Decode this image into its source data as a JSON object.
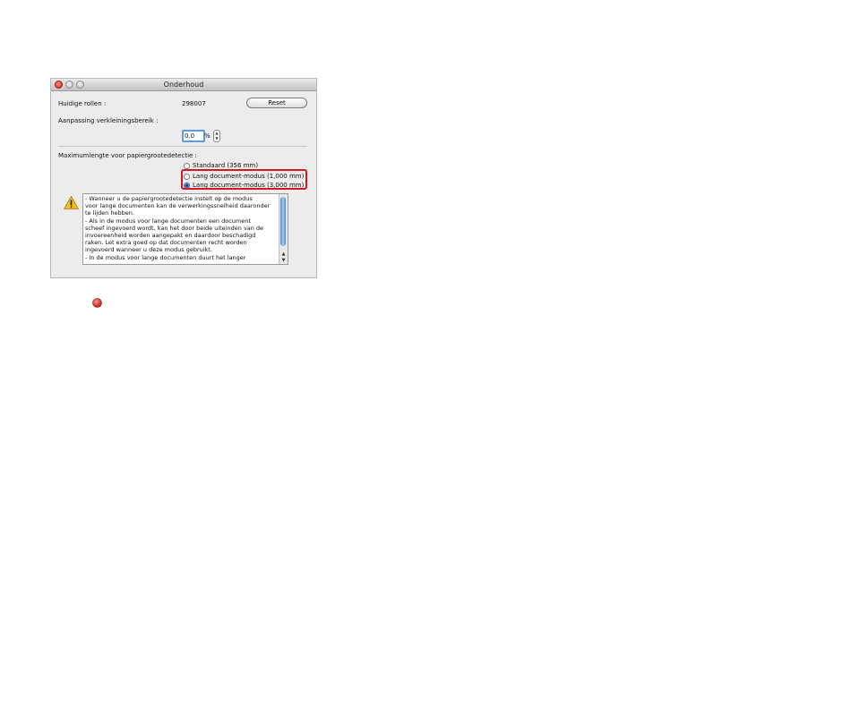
{
  "window": {
    "title": "Onderhoud"
  },
  "maintenance": {
    "rollers_label": "Huidige rollen :",
    "rollers_value": "298007",
    "reset_label": "Reset",
    "reduction_label": "Aanpassing verkleiningsbereik :",
    "reduction_value": "0.0",
    "percent_symbol": "%"
  },
  "detection": {
    "label": "Maximumlengte voor papiergrootedetectie :",
    "options": [
      {
        "label": "Standaard (356 mm)",
        "selected": false
      },
      {
        "label": "Lang document-modus (1,000 mm)",
        "selected": false
      },
      {
        "label": "Lang document-modus (3,000 mm)",
        "selected": true
      }
    ]
  },
  "warning": {
    "icon": "warning-triangle-icon",
    "lines": [
      "- Wanneer u de papiergrootedetectie instelt op de modus",
      "voor lange documenten kan de verwerkingssnelheid daaronder",
      "te lijden hebben.",
      "- Als in de modus voor lange documenten een document",
      "scheef ingevoerd wordt, kan het door beide uiteinden van de",
      "invoereenheid worden aangepakt en daardoor beschadigd",
      "raken. Let extra goed op dat documenten recht worden",
      "ingevoerd wanneer u deze modus gebruikt.",
      "- In de modus voor lange documenten duurt het langer"
    ]
  },
  "colors": {
    "highlight": "#d3191f",
    "bullet": "#d62a22"
  },
  "footer_icon": "red-bullet-icon"
}
